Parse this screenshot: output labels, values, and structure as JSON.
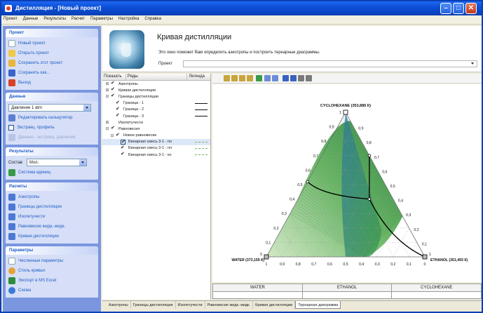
{
  "window": {
    "title": "Дистилляция - [Новый проект]",
    "controls": {
      "minimize": "–",
      "maximize": "□",
      "close": "✕"
    }
  },
  "menu": [
    "Проект",
    "Данные",
    "Результаты",
    "Расчет",
    "Параметры",
    "Настройка",
    "Справка"
  ],
  "sidebar": {
    "project": {
      "title": "Проект",
      "items": [
        {
          "label": "Новый проект",
          "icon": "new-document-icon"
        },
        {
          "label": "Открыть проект",
          "icon": "open-folder-icon"
        },
        {
          "label": "Сохранить этот проект",
          "icon": "folder-save-icon"
        },
        {
          "label": "Сохранить как...",
          "icon": "save-disk-icon"
        },
        {
          "label": "Выход",
          "icon": "exit-icon"
        }
      ]
    },
    "data": {
      "title": "Данные",
      "pressure": "Давление 1 atm",
      "items": [
        {
          "label": "Редактировать калькулятор",
          "icon": "calculator-icon"
        },
        {
          "label": "Экстракц. профиль",
          "icon": "checkbox"
        },
        {
          "label": "Данные - экстракц. давления",
          "icon": "disabled-grid-icon"
        }
      ]
    },
    "results": {
      "title": "Результаты",
      "composition_label": "Состав",
      "composition_value": "Мол.",
      "units_item": "Система единиц"
    },
    "calcs": {
      "title": "Расчеты",
      "items": [
        {
          "label": "Азеотропы"
        },
        {
          "label": "Границы дистилляции"
        },
        {
          "label": "Изолетучести"
        },
        {
          "label": "Равновесие жидк.-жидк."
        },
        {
          "label": "Кривая дистилляции"
        }
      ]
    },
    "params": {
      "title": "Параметры",
      "items": [
        {
          "label": "Численные параметры",
          "icon": "list-icon"
        },
        {
          "label": "Стиль кривых",
          "icon": "palette-icon"
        },
        {
          "label": "Экспорт в MS Excel",
          "icon": "excel-icon"
        },
        {
          "label": "Схема",
          "icon": "globe-icon"
        }
      ]
    }
  },
  "header": {
    "title": "Кривая дистилляции",
    "subtitle": "Это окно поможет Вам определить азеотропы и построить тернарные диаграммы.",
    "project_label": "Проект"
  },
  "tree": {
    "col_show": "Показать",
    "col_rows": "Ряды",
    "col_legend": "Легенда",
    "rows": [
      {
        "label": "Азеотропы",
        "exp": "⊞",
        "checked": true,
        "indent": 0
      },
      {
        "label": "Кривая дистилляции",
        "exp": "⊞",
        "checked": true,
        "indent": 0
      },
      {
        "label": "Границы дистилляции",
        "exp": "⊟",
        "checked": true,
        "indent": 0
      },
      {
        "label": "Граница - 1",
        "exp": "",
        "checked": true,
        "indent": 1,
        "legend": "solid"
      },
      {
        "label": "Граница - 2",
        "exp": "",
        "checked": true,
        "indent": 1,
        "legend": "solid"
      },
      {
        "label": "Граница - 3",
        "exp": "",
        "checked": true,
        "indent": 1,
        "legend": "solid"
      },
      {
        "label": "Изолетучести",
        "exp": "⊞",
        "checked": false,
        "indent": 0
      },
      {
        "label": "Равновесия",
        "exp": "⊟",
        "checked": true,
        "indent": 0
      },
      {
        "label": "Новое равновесие",
        "exp": "⊟",
        "checked": true,
        "indent": 1
      },
      {
        "label": "Бинарная смесь 3-1 - по",
        "exp": "",
        "checked": true,
        "indent": 2,
        "legend": "dash",
        "box": true
      },
      {
        "label": "Бинарная смесь 3-1 - пл",
        "exp": "",
        "checked": true,
        "indent": 2,
        "legend": "dash"
      },
      {
        "label": "Бинарная смесь 3-1 - ко",
        "exp": "",
        "checked": true,
        "indent": 2,
        "legend": "dash"
      }
    ]
  },
  "toolbar": {
    "icons": [
      "pointer-icon",
      "grid-icon",
      "grid-icon",
      "grid-icon",
      "grid-icon",
      "flag-icon",
      "zoom-in-icon",
      "zoom-out-icon",
      "table-icon",
      "save-icon",
      "print-icon",
      "print-preview-icon"
    ]
  },
  "diagram": {
    "top_vertex": "CYCLOHEXANE (353,885 К)",
    "left_vertex": "WATER (373,159 К)",
    "right_vertex": "ETHANOL (351,493 К)",
    "bottom_ticks": [
      "1",
      "0,9",
      "0,8",
      "0,7",
      "0,6",
      "0,5",
      "0,4",
      "0,3",
      "0,2",
      "0,1",
      "0"
    ],
    "left_ticks": [
      "0",
      "0,1",
      "0,2",
      "0,3",
      "0,4",
      "0,5",
      "0,6",
      "0,7",
      "0,8",
      "0,9",
      "1"
    ],
    "right_ticks": [
      "0",
      "0,1",
      "0,2",
      "0,3",
      "0,4",
      "0,5",
      "0,6",
      "0,7",
      "0,8",
      "0,9",
      "1"
    ],
    "vertex_markers": {
      "top": "1",
      "left": "0",
      "right": "1"
    }
  },
  "composition": {
    "headers": [
      "WATER",
      "ETHANOL",
      "CYCLOHEXANE"
    ],
    "values": [
      "",
      "",
      ""
    ]
  },
  "tabs": {
    "items": [
      "Азеотропы",
      "Границы дистилляции",
      "Изолетучести",
      "Равновесие жидк.-жидк.",
      "Кривая дистилляции",
      "Тернарная диаграмма"
    ],
    "active": 5
  },
  "colors": {
    "titlebar": "#0b4fd6",
    "taskpane": "#7a96df",
    "region_green": "#3a9a48",
    "region_blue": "#2a7ea0",
    "boundary": "#000000"
  }
}
